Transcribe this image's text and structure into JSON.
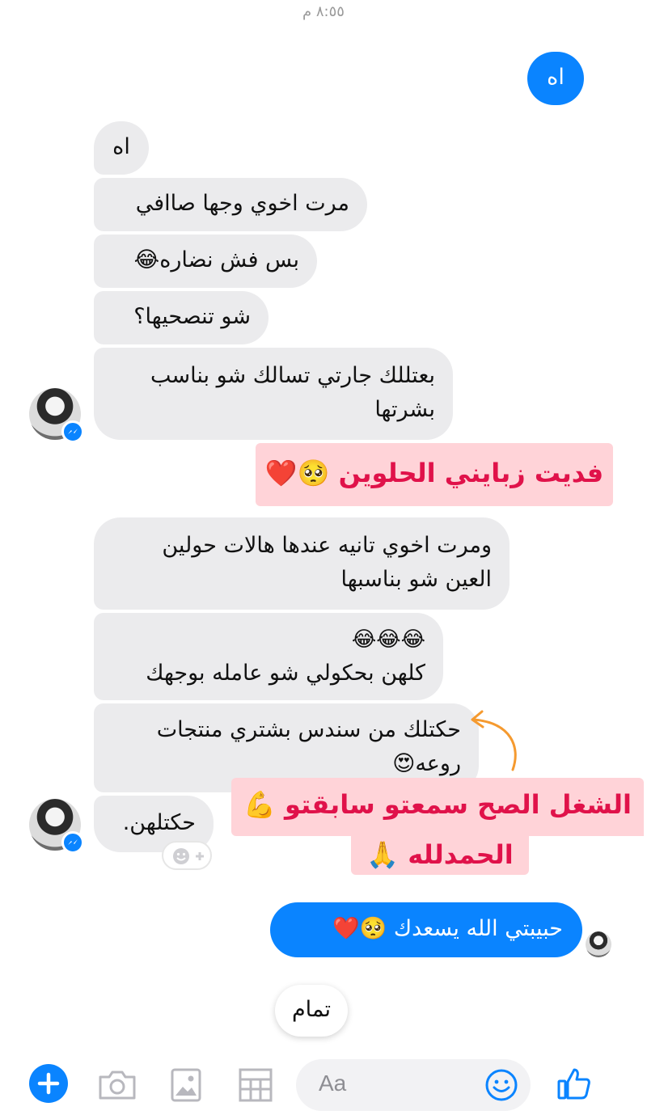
{
  "timestamp": "٨:٥٥ م",
  "messages": {
    "sent_1": "اه",
    "recv_1": "اه",
    "recv_2": "مرت اخوي وجها صاافي",
    "recv_3": "بس فش نضاره😂",
    "recv_4": "شو تنصحيها؟",
    "recv_5_line1": "بعتللك جارتي تسالك شو بناسب",
    "recv_5_line2": "بشرتها",
    "recv_6_line1": "ومرت اخوي تانيه عندها هالات حولين",
    "recv_6_line2": "العين شو بناسبها",
    "recv_7_line1": "😂😂😂",
    "recv_7_line2": "كلهن بحكولي شو عامله بوجهك",
    "recv_8_line1": "حكتلك من سندس بشتري منتجات",
    "recv_8_line2": "روعه😍",
    "recv_9": "حكتلهن.",
    "sent_2": "حبيبتي الله يسعدك 🥺❤️",
    "quick_reply": "تمام"
  },
  "overlays": {
    "caption_1": "فديت زبايني الحلوين 🥺❤️",
    "caption_2_line1": "الشغل الصح سمعتو سابقتو 💪",
    "caption_2_line2": "الحمدلله 🙏"
  },
  "composer": {
    "placeholder": "Aa"
  },
  "icons": [
    "plus-icon",
    "camera-icon",
    "photo-icon",
    "table-icon",
    "smile-icon",
    "like-icon",
    "messenger-badge-icon"
  ],
  "colors": {
    "accent": "#0a84ff",
    "received_bubble": "#ebebed",
    "caption_text": "#e0124a",
    "caption_bg": "#ffd3d8",
    "arrow": "#f59a2f"
  }
}
